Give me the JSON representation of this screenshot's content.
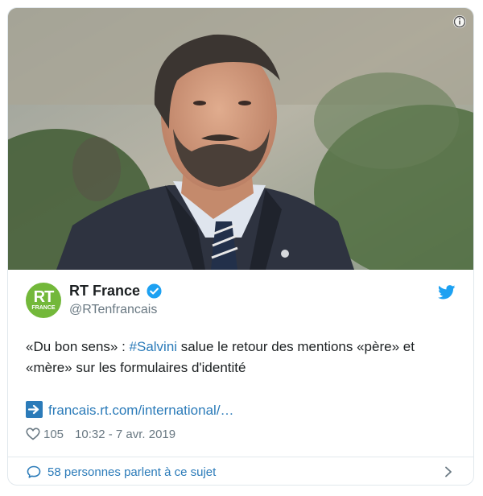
{
  "tweet": {
    "author_name": "RT France",
    "author_handle": "@RTenfrancais",
    "avatar_text": "RT",
    "avatar_subtext": "FRANCE",
    "text_prefix": "«Du bon sens» : ",
    "hashtag": "#Salvini",
    "text_suffix": " salue le retour des mentions «père» et «mère» sur les formulaires d'identité",
    "link_text": "francais.rt.com/international/…",
    "like_count": "105",
    "timestamp": "10:32 - 7 avr. 2019",
    "footer_text": "58 personnes parlent à ce sujet"
  },
  "icons": {
    "info": "info-icon",
    "verified": "verified-badge-icon",
    "twitter": "twitter-bird-icon",
    "link_arrow": "arrow-right-icon",
    "like": "heart-icon",
    "conversation": "speech-bubble-icon",
    "chevron": "chevron-right-icon"
  },
  "colors": {
    "link": "#2b7bb9",
    "meta": "#697882",
    "avatar_bg": "#73b83a",
    "verified": "#1da1f2"
  }
}
